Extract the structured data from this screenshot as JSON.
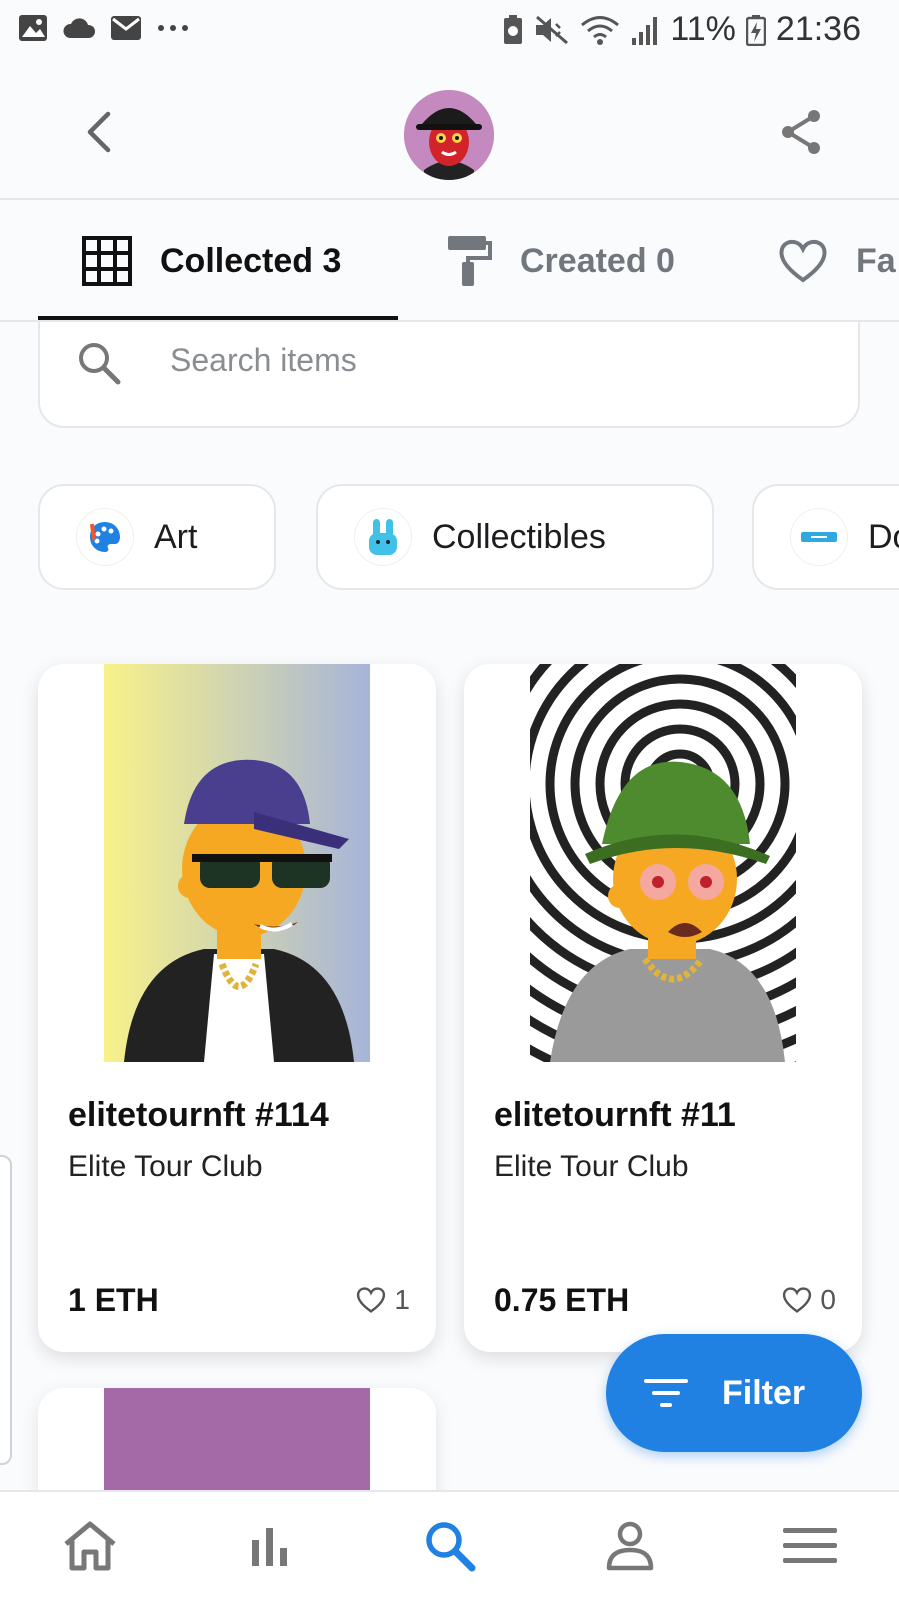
{
  "status_bar": {
    "battery": "11%",
    "time": "21:36",
    "notification_icons": [
      "image-icon",
      "cloud-icon",
      "mail-icon",
      "more-dots-icon"
    ],
    "system_icons": [
      "battery-saver-icon",
      "mute-icon",
      "wifi-icon",
      "signal-icon",
      "battery-charging-icon"
    ]
  },
  "header": {
    "back_icon": "chevron-left-icon",
    "avatar": "profile-avatar",
    "share_icon": "share-icon"
  },
  "tabs": [
    {
      "label": "Collected 3",
      "icon": "grid-icon",
      "active": true
    },
    {
      "label": "Created 0",
      "icon": "paint-roller-icon",
      "active": false
    },
    {
      "label": "Fa",
      "icon": "heart-icon",
      "active": false
    }
  ],
  "search": {
    "placeholder": "Search items"
  },
  "categories": [
    {
      "label": "Art",
      "icon": "palette-icon"
    },
    {
      "label": "Collectibles",
      "icon": "bunny-icon"
    },
    {
      "label": "Do",
      "icon": "domain-icon"
    }
  ],
  "items": [
    {
      "name": "elitetournft #114",
      "collection": "Elite Tour Club",
      "price": "1 ETH",
      "likes": "1"
    },
    {
      "name": "elitetournft #11",
      "collection": "Elite Tour Club",
      "price": "0.75 ETH",
      "likes": "0"
    }
  ],
  "filter_button": {
    "label": "Filter"
  },
  "bottom_nav": [
    {
      "name": "home",
      "icon": "home-icon"
    },
    {
      "name": "stats",
      "icon": "bar-chart-icon"
    },
    {
      "name": "search",
      "icon": "search-icon",
      "active": true
    },
    {
      "name": "account",
      "icon": "person-icon"
    },
    {
      "name": "menu",
      "icon": "menu-icon"
    }
  ],
  "colors": {
    "accent": "#2081e2",
    "text": "#111111",
    "muted": "#72777d",
    "border": "#e5e7ea"
  }
}
